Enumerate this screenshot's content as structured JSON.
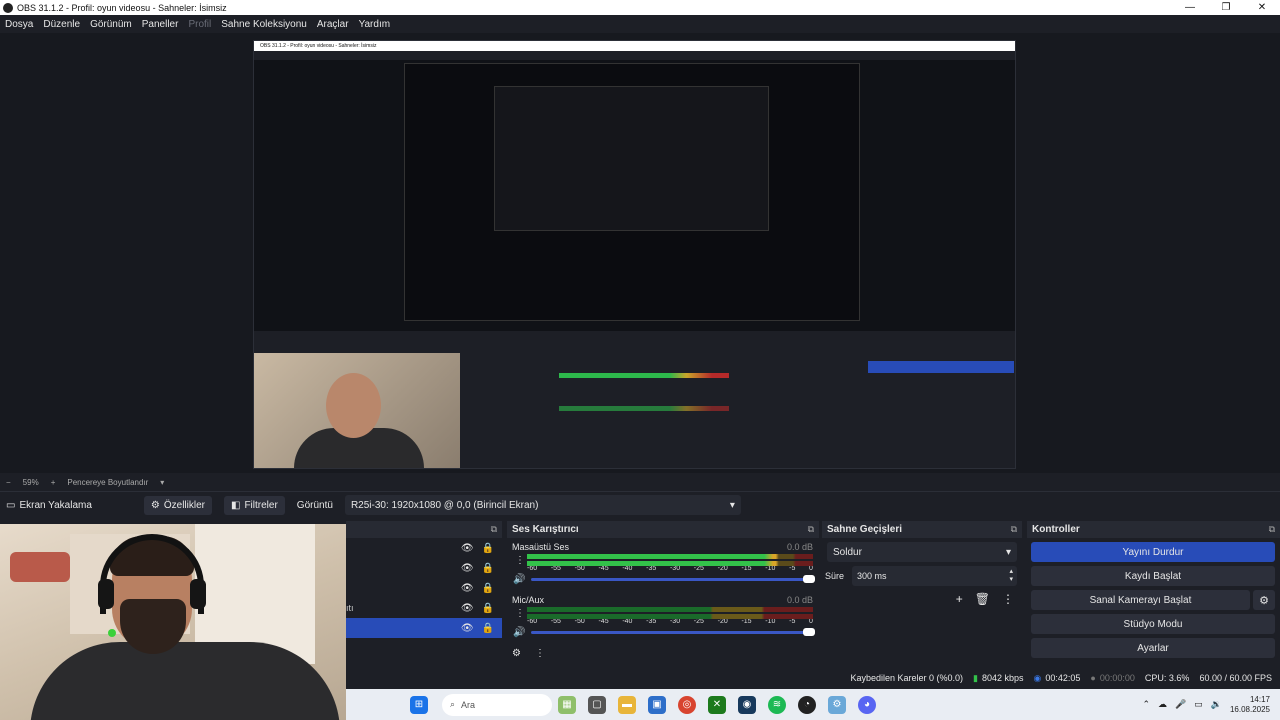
{
  "window": {
    "title": "OBS 31.1.2 - Profil: oyun videosu - Sahneler: İsimsiz"
  },
  "menu": [
    "Dosya",
    "Düzenle",
    "Görünüm",
    "Paneller",
    "Profil",
    "Sahne Koleksiyonu",
    "Araçlar",
    "Yardım"
  ],
  "zoom": {
    "value": "59%",
    "mode": "Pencereye Boyutlandır"
  },
  "source_toolbar": {
    "source_name": "Ekran Yakalama",
    "properties": "Özellikler",
    "filters": "Filtreler",
    "display_label": "Görüntü",
    "display_value": "R25i-30: 1920x1080 @ 0,0 (Birincil Ekran)"
  },
  "sources": {
    "partial_label": "ıtı"
  },
  "mixer": {
    "title": "Ses Karıştırıcı",
    "channels": [
      {
        "name": "Masaüstü Ses",
        "db": "0.0 dB"
      },
      {
        "name": "Mic/Aux",
        "db": "0.0 dB"
      }
    ],
    "ticks": [
      "-60",
      "-55",
      "-50",
      "-45",
      "-40",
      "-35",
      "-30",
      "-25",
      "-20",
      "-15",
      "-10",
      "-5",
      "0"
    ]
  },
  "transitions": {
    "title": "Sahne Geçişleri",
    "selected": "Soldur",
    "duration_label": "Süre",
    "duration_value": "300 ms"
  },
  "controls": {
    "title": "Kontroller",
    "stop_stream": "Yayını Durdur",
    "start_recording": "Kaydı Başlat",
    "start_virtual_cam": "Sanal Kamerayı Başlat",
    "studio_mode": "Stüdyo Modu",
    "settings": "Ayarlar"
  },
  "status": {
    "dropped_frames": "Kaybedilen Kareler 0 (%0.0)",
    "bitrate": "8042 kbps",
    "stream_time": "00:42:05",
    "rec_time": "00:00:00",
    "cpu": "CPU: 3.6%",
    "fps": "60.00 / 60.00 FPS"
  },
  "taskbar": {
    "search": "Ara",
    "time": "14:17",
    "date": "16.08.2025"
  },
  "colors": {
    "accent": "#284cb8",
    "meter_green": "#33c24a",
    "meter_yellow": "#d9a528",
    "meter_red": "#6a1d1d"
  }
}
